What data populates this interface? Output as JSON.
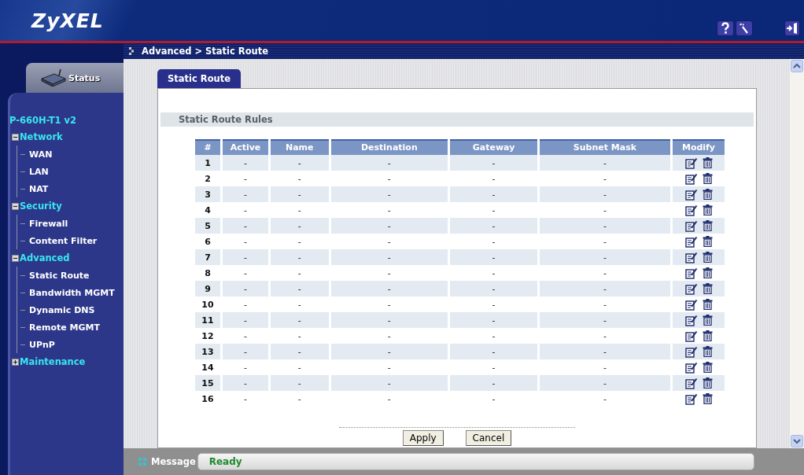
{
  "header": {
    "logo": "ZyXEL"
  },
  "breadcrumb": "Advanced > Static Route",
  "sidebar": {
    "status_tab": "Status",
    "model": "P-660H-T1 v2",
    "sections": [
      {
        "label": "Network",
        "expanded": true,
        "children": [
          {
            "label": "WAN"
          },
          {
            "label": "LAN"
          },
          {
            "label": "NAT"
          }
        ]
      },
      {
        "label": "Security",
        "expanded": true,
        "children": [
          {
            "label": "Firewall"
          },
          {
            "label": "Content Filter"
          }
        ]
      },
      {
        "label": "Advanced",
        "expanded": true,
        "children": [
          {
            "label": "Static Route"
          },
          {
            "label": "Bandwidth MGMT"
          },
          {
            "label": "Dynamic DNS"
          },
          {
            "label": "Remote MGMT"
          },
          {
            "label": "UPnP"
          }
        ]
      },
      {
        "label": "Maintenance",
        "expanded": false
      }
    ]
  },
  "tabs": [
    {
      "label": "Static Route",
      "selected": true
    }
  ],
  "section_title": "Static Route Rules",
  "table": {
    "columns": [
      "#",
      "Active",
      "Name",
      "Destination",
      "Gateway",
      "Subnet Mask",
      "Modify"
    ],
    "rows": [
      {
        "cells": [
          "1",
          "-",
          "-",
          "-",
          "-",
          "-"
        ]
      },
      {
        "cells": [
          "2",
          "-",
          "-",
          "-",
          "-",
          "-"
        ]
      },
      {
        "cells": [
          "3",
          "-",
          "-",
          "-",
          "-",
          "-"
        ]
      },
      {
        "cells": [
          "4",
          "-",
          "-",
          "-",
          "-",
          "-"
        ]
      },
      {
        "cells": [
          "5",
          "-",
          "-",
          "-",
          "-",
          "-"
        ]
      },
      {
        "cells": [
          "6",
          "-",
          "-",
          "-",
          "-",
          "-"
        ]
      },
      {
        "cells": [
          "7",
          "-",
          "-",
          "-",
          "-",
          "-"
        ]
      },
      {
        "cells": [
          "8",
          "-",
          "-",
          "-",
          "-",
          "-"
        ]
      },
      {
        "cells": [
          "9",
          "-",
          "-",
          "-",
          "-",
          "-"
        ]
      },
      {
        "cells": [
          "10",
          "-",
          "-",
          "-",
          "-",
          "-"
        ]
      },
      {
        "cells": [
          "11",
          "-",
          "-",
          "-",
          "-",
          "-"
        ]
      },
      {
        "cells": [
          "12",
          "-",
          "-",
          "-",
          "-",
          "-"
        ]
      },
      {
        "cells": [
          "13",
          "-",
          "-",
          "-",
          "-",
          "-"
        ]
      },
      {
        "cells": [
          "14",
          "-",
          "-",
          "-",
          "-",
          "-"
        ]
      },
      {
        "cells": [
          "15",
          "-",
          "-",
          "-",
          "-",
          "-"
        ]
      },
      {
        "cells": [
          "16",
          "-",
          "-",
          "-",
          "-",
          "-"
        ]
      }
    ]
  },
  "buttons": [
    "Apply",
    "Cancel"
  ],
  "status_bar": {
    "label": "Message",
    "value": "Ready"
  }
}
